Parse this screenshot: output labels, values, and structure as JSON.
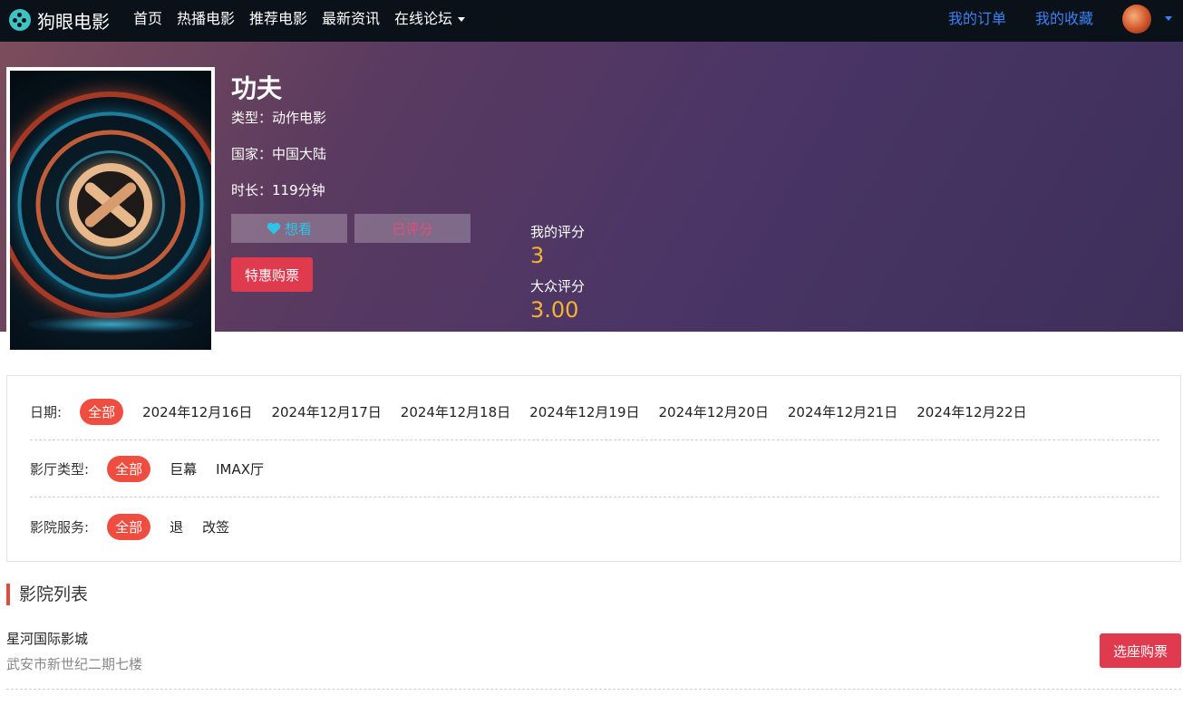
{
  "nav": {
    "brand": "狗眼电影",
    "links": [
      "首页",
      "热播电影",
      "推荐电影",
      "最新资讯",
      "在线论坛"
    ],
    "right": [
      "我的订单",
      "我的收藏"
    ]
  },
  "movie": {
    "title": "功夫",
    "type": "类型：动作电影",
    "country": "国家：中国大陆",
    "duration": "时长：119分钟",
    "want_label": "想看",
    "rated_label": "已评分",
    "buy_label": "特惠购票",
    "my_score_label": "我的评分",
    "my_score": "3",
    "public_score_label": "大众评分",
    "public_score": "3.00"
  },
  "filters": {
    "date": {
      "label": "日期:",
      "options": [
        "全部",
        "2024年12月16日",
        "2024年12月17日",
        "2024年12月18日",
        "2024年12月19日",
        "2024年12月20日",
        "2024年12月21日",
        "2024年12月22日"
      ],
      "selected": "全部"
    },
    "hall": {
      "label": "影厅类型:",
      "options": [
        "全部",
        "巨幕",
        "IMAX厅"
      ],
      "selected": "全部"
    },
    "service": {
      "label": "影院服务:",
      "options": [
        "全部",
        "退",
        "改签"
      ],
      "selected": "全部"
    }
  },
  "cinemas": {
    "section_title": "影院列表",
    "items": [
      {
        "name": "星河国际影城",
        "address": "武安市新世纪二期七楼",
        "button": "选座购票"
      }
    ]
  },
  "colors": {
    "navbar_bg": "#0b1118",
    "nav_link_blue": "#3b82f6",
    "accent_red": "#e03a4e",
    "tag_active": "#ee4d3f",
    "score": "#f5b335"
  }
}
